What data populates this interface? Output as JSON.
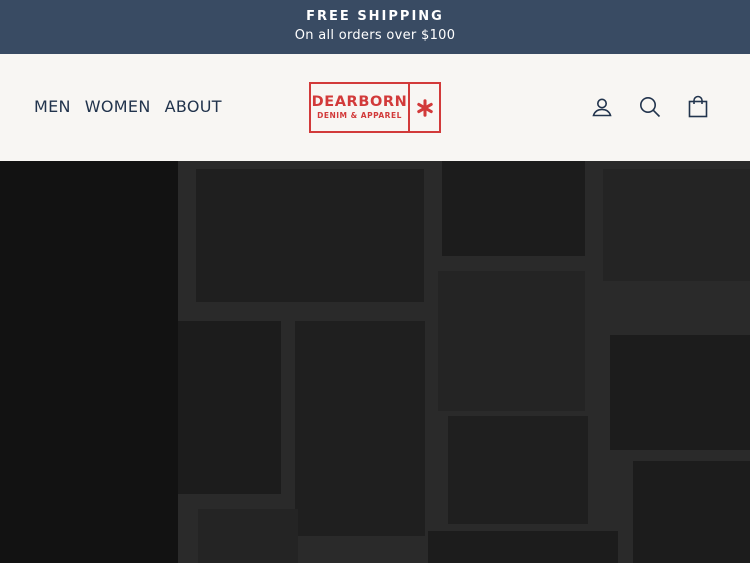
{
  "announcement": {
    "title": "FREE SHIPPING",
    "subtitle": "On all orders over $100"
  },
  "nav": {
    "items": [
      {
        "label": "MEN"
      },
      {
        "label": "WOMEN"
      },
      {
        "label": "ABOUT"
      }
    ]
  },
  "logo": {
    "brand": "DEARBORN",
    "tagline": "DENIM & APPAREL",
    "star_icon": "six-point-star-icon",
    "color": "#d23a3a"
  },
  "header_icons": {
    "account": "user-icon",
    "search": "search-icon",
    "cart": "shopping-bag-icon"
  },
  "colors": {
    "announcement_bg": "#394b63",
    "header_bg": "#f8f6f3",
    "nav_text": "#22344d",
    "accent_red": "#d23a3a"
  }
}
